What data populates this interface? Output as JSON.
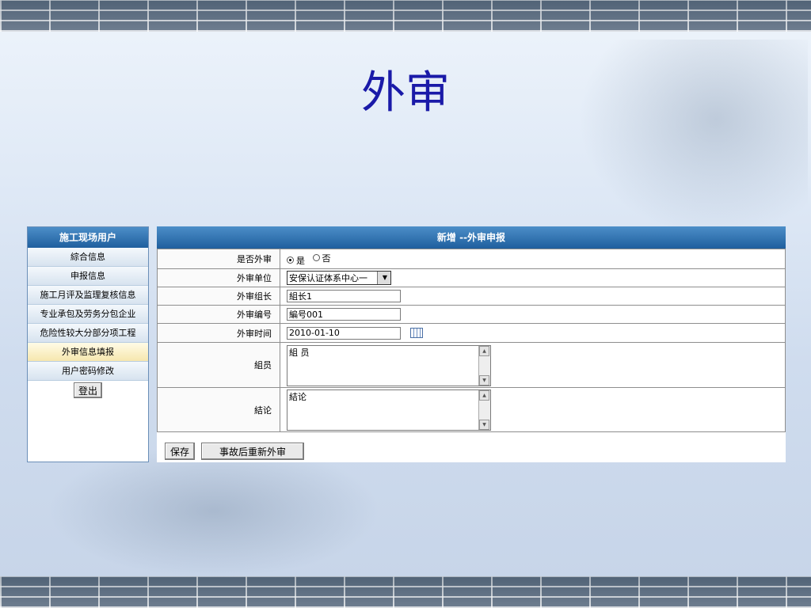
{
  "slide": {
    "title": "外审"
  },
  "sidebar": {
    "header": "施工现场用户",
    "items": [
      {
        "label": "綜合信息"
      },
      {
        "label": "申报信息"
      },
      {
        "label": "施工月评及监理复核信息"
      },
      {
        "label": "专业承包及劳务分包企业"
      },
      {
        "label": "危险性较大分部分项工程"
      },
      {
        "label": "外审信息填报",
        "active": true
      },
      {
        "label": "用户密码修改"
      }
    ],
    "logout_label": "登出"
  },
  "form": {
    "header": "新增 --外审申报",
    "is_external_audit": {
      "label": "是否外审",
      "yes": "是",
      "no": "否",
      "selected": "yes"
    },
    "audit_unit": {
      "label": "外审单位",
      "value": "安保认证体系中心一"
    },
    "audit_leader": {
      "label": "外审组长",
      "value": "組长1"
    },
    "audit_number": {
      "label": "外审编号",
      "value": "編号001"
    },
    "audit_time": {
      "label": "外审时间",
      "value": "2010-01-10"
    },
    "members": {
      "label": "組员",
      "value": "組 员"
    },
    "conclusion": {
      "label": "結论",
      "value": "結论"
    },
    "save_label": "保存",
    "reaudit_label": "事故后重新外审"
  }
}
